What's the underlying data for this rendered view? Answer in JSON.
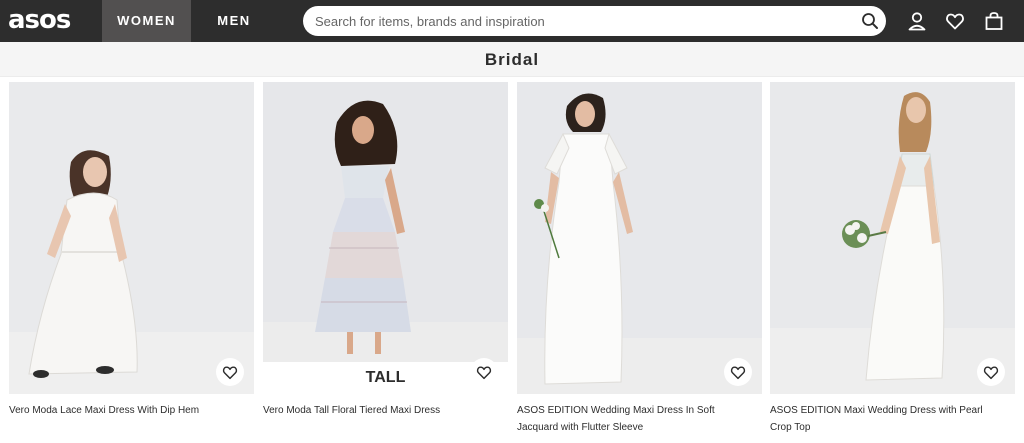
{
  "header": {
    "logo": "asos",
    "tabs": [
      {
        "label": "WOMEN",
        "active": true
      },
      {
        "label": "MEN",
        "active": false
      }
    ],
    "search_placeholder": "Search for items, brands and inspiration",
    "icons": [
      "search-icon",
      "account-icon",
      "heart-icon",
      "bag-icon"
    ]
  },
  "page": {
    "title": "Bridal"
  },
  "products": [
    {
      "title": "Vero Moda Lace Maxi Dress With Dip Hem",
      "badge": ""
    },
    {
      "title": "Vero Moda Tall Floral Tiered Maxi Dress",
      "badge": "TALL"
    },
    {
      "title": "ASOS EDITION Wedding Maxi Dress In Soft Jacquard with Flutter Sleeve",
      "badge": ""
    },
    {
      "title": "ASOS EDITION Maxi Wedding Dress with Pearl Crop Top",
      "badge": ""
    }
  ],
  "colors": {
    "header_bg": "#2d2d2d",
    "active_tab_bg": "#525050",
    "subbar_bg": "#f5f5f5",
    "text": "#2d2d2d"
  }
}
